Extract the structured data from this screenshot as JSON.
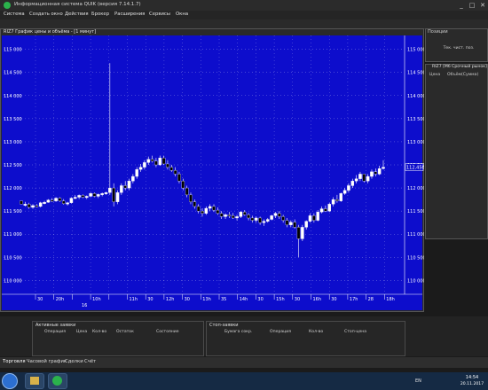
{
  "window": {
    "title": "Информационная система QUIK (версия 7.14.1.7)",
    "controls": {
      "minimize": "_",
      "maximize": "□",
      "close": "✕"
    }
  },
  "menu": [
    "Система",
    "Создать окно",
    "Действия",
    "Брокер",
    "Расширения",
    "Сервисы",
    "Окна"
  ],
  "chart": {
    "caption": "RIZ7 График цены и объёма - [1 минут]",
    "current_price": "112,450",
    "y_ticks": [
      "115 000",
      "114 500",
      "114 000",
      "113 500",
      "113 000",
      "112 500",
      "112 000",
      "111 500",
      "111 000",
      "110 500",
      "110 000"
    ],
    "x_ticks": [
      "30",
      "20h",
      "",
      "10h",
      "",
      "11h",
      "30",
      "12h",
      "30",
      "13h",
      "35",
      "14h",
      "30",
      "15h",
      "30",
      "16h",
      "30",
      "17h",
      "28",
      "18h"
    ],
    "date_label": "16"
  },
  "chart_data": {
    "type": "candlestick",
    "y_unit": "price",
    "ylim": [
      109700,
      115300
    ],
    "candles": [
      [
        111720,
        111720,
        111650,
        111650
      ],
      [
        111650,
        111700,
        111600,
        111650
      ],
      [
        111650,
        111680,
        111550,
        111580
      ],
      [
        111580,
        111650,
        111550,
        111620
      ],
      [
        111620,
        111650,
        111580,
        111600
      ],
      [
        111600,
        111700,
        111580,
        111680
      ],
      [
        111680,
        111720,
        111650,
        111690
      ],
      [
        111690,
        111760,
        111680,
        111740
      ],
      [
        111740,
        111780,
        111700,
        111720
      ],
      [
        111720,
        111800,
        111700,
        111780
      ],
      [
        111780,
        111800,
        111700,
        111720
      ],
      [
        111720,
        111760,
        111640,
        111660
      ],
      [
        111660,
        111700,
        111620,
        111680
      ],
      [
        111680,
        111800,
        111660,
        111780
      ],
      [
        111780,
        111850,
        111760,
        111800
      ],
      [
        111800,
        111860,
        111760,
        111840
      ],
      [
        111840,
        111860,
        111780,
        111800
      ],
      [
        111800,
        111840,
        111760,
        111820
      ],
      [
        111820,
        111900,
        111800,
        111880
      ],
      [
        111880,
        111900,
        111800,
        111820
      ],
      [
        111820,
        111880,
        111780,
        111860
      ],
      [
        111860,
        111900,
        111820,
        111880
      ],
      [
        111880,
        111920,
        111850,
        111900
      ],
      [
        111900,
        114700,
        111850,
        112000
      ],
      [
        112000,
        112100,
        111600,
        111700
      ],
      [
        111700,
        111950,
        111650,
        111900
      ],
      [
        111900,
        112100,
        111850,
        112050
      ],
      [
        112050,
        112150,
        111950,
        112000
      ],
      [
        112000,
        112200,
        111950,
        112150
      ],
      [
        112150,
        112300,
        112100,
        112250
      ],
      [
        112250,
        112450,
        112200,
        112400
      ],
      [
        112400,
        112520,
        112350,
        112450
      ],
      [
        112450,
        112600,
        112400,
        112550
      ],
      [
        112550,
        112680,
        112500,
        112620
      ],
      [
        112620,
        112700,
        112550,
        112580
      ],
      [
        112580,
        112650,
        112450,
        112500
      ],
      [
        112500,
        112700,
        112480,
        112650
      ],
      [
        112650,
        112700,
        112500,
        112520
      ],
      [
        112520,
        112600,
        112400,
        112450
      ],
      [
        112450,
        112500,
        112350,
        112380
      ],
      [
        112380,
        112450,
        112250,
        112300
      ],
      [
        112300,
        112350,
        112100,
        112150
      ],
      [
        112150,
        112200,
        111950,
        112000
      ],
      [
        112000,
        112050,
        111800,
        111850
      ],
      [
        111850,
        111900,
        111650,
        111700
      ],
      [
        111700,
        111750,
        111550,
        111600
      ],
      [
        111600,
        111650,
        111450,
        111500
      ],
      [
        111500,
        111560,
        111380,
        111450
      ],
      [
        111450,
        111600,
        111420,
        111560
      ],
      [
        111560,
        111650,
        111500,
        111600
      ],
      [
        111600,
        111650,
        111480,
        111520
      ],
      [
        111520,
        111580,
        111420,
        111450
      ],
      [
        111450,
        111500,
        111330,
        111380
      ],
      [
        111380,
        111450,
        111330,
        111420
      ],
      [
        111420,
        111480,
        111350,
        111400
      ],
      [
        111400,
        111460,
        111330,
        111350
      ],
      [
        111350,
        111420,
        111300,
        111380
      ],
      [
        111380,
        111500,
        111350,
        111480
      ],
      [
        111480,
        111520,
        111400,
        111420
      ],
      [
        111420,
        111460,
        111300,
        111350
      ],
      [
        111350,
        111400,
        111250,
        111300
      ],
      [
        111300,
        111380,
        111250,
        111350
      ],
      [
        111350,
        111380,
        111200,
        111250
      ],
      [
        111250,
        111320,
        111180,
        111280
      ],
      [
        111280,
        111350,
        111250,
        111320
      ],
      [
        111320,
        111420,
        111300,
        111400
      ],
      [
        111400,
        111480,
        111350,
        111450
      ],
      [
        111450,
        111500,
        111330,
        111380
      ],
      [
        111380,
        111420,
        111250,
        111300
      ],
      [
        111300,
        111350,
        111150,
        111200
      ],
      [
        111200,
        111300,
        111150,
        111260
      ],
      [
        111260,
        111320,
        111120,
        111150
      ],
      [
        111150,
        111200,
        110500,
        110900
      ],
      [
        110900,
        111200,
        110850,
        111150
      ],
      [
        111150,
        111300,
        111100,
        111280
      ],
      [
        111280,
        111450,
        111250,
        111400
      ],
      [
        111400,
        111450,
        111250,
        111300
      ],
      [
        111300,
        111520,
        111280,
        111480
      ],
      [
        111480,
        111600,
        111450,
        111550
      ],
      [
        111550,
        111620,
        111480,
        111500
      ],
      [
        111500,
        111680,
        111480,
        111650
      ],
      [
        111650,
        111800,
        111600,
        111750
      ],
      [
        111750,
        111850,
        111680,
        111720
      ],
      [
        111720,
        111900,
        111700,
        111880
      ],
      [
        111880,
        112000,
        111850,
        111950
      ],
      [
        111950,
        112100,
        111900,
        112050
      ],
      [
        112050,
        112200,
        112000,
        112150
      ],
      [
        112150,
        112280,
        112100,
        112200
      ],
      [
        112200,
        112350,
        112150,
        112300
      ],
      [
        112300,
        112300,
        112120,
        112150
      ],
      [
        112150,
        112300,
        112100,
        112250
      ],
      [
        112250,
        112400,
        112200,
        112350
      ],
      [
        112350,
        112420,
        112250,
        112300
      ],
      [
        112300,
        112480,
        112280,
        112420
      ],
      [
        112420,
        112600,
        112400,
        112450
      ]
    ]
  },
  "positions": {
    "caption": "Позиции",
    "column": "Тек. чист. поз."
  },
  "order_book": {
    "caption": "RIZ7 [Мб Срочный рынок]",
    "price_col": "Цена",
    "vol_col": "Объём(Сумма)"
  },
  "active_orders": {
    "title": "Активные заявки",
    "columns": [
      "Операция",
      "Цена",
      "Кол-во",
      "Остаток",
      "Состояние"
    ]
  },
  "stop_orders": {
    "title": "Стоп-заявки",
    "columns": [
      "Бумага сокр.",
      "Операция",
      "Кол-во",
      "Стоп-цена"
    ]
  },
  "tabs": [
    "Торговля",
    "Часовой график",
    "Сделки",
    "Счёт"
  ],
  "taskbar": {
    "lang": "EN",
    "time": "14:54",
    "date": "20.11.2017"
  }
}
